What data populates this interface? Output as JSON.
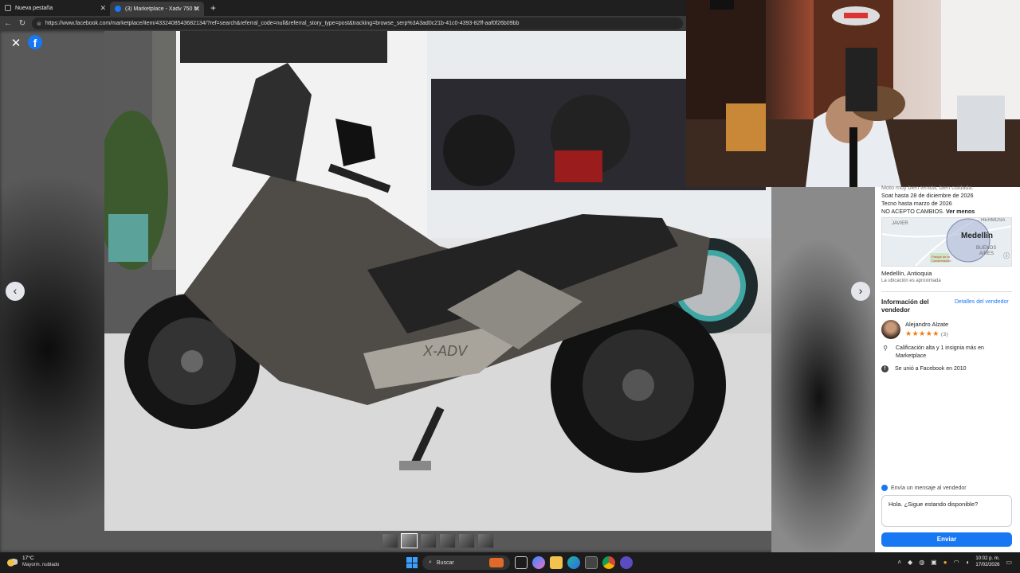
{
  "browser": {
    "tabs": [
      {
        "title": "Nueva pestaña"
      },
      {
        "title": "(3) Marketplace - Xadv 750 Mode..."
      }
    ],
    "url": "https://www.facebook.com/marketplace/item/4332408543682134/?ref=search&referral_code=null&referral_story_type=post&tracking=browse_serp%3A3ad0c21b-41c0-4393-82ff-aaf0f26b09bb"
  },
  "viewer": {
    "thumb_count": 6
  },
  "panel": {
    "desc_top": "Moto muy bien tenida, bien cuidada.",
    "desc_lines": [
      "Soat hasta 28 de diciembre de 2026",
      "Tecno hasta marzo de 2026",
      "NO ACEPTO CAMBIOS."
    ],
    "see_less": "Ver menos",
    "map": {
      "city": "Medellín",
      "labels": [
        "JAVIER",
        "HERMOSA",
        "BUENOS",
        "AIRES",
        "Parque de la Conservación"
      ]
    },
    "location": "Medellín, Antioquia",
    "location_note": "La ubicación es aproximada",
    "seller_section_title": "Información del vendedor",
    "seller_details_link": "Detalles del vendedor",
    "seller_name": "Alejandro Alzate",
    "rating_stars": "★★★★★",
    "rating_count": "(3)",
    "info_1": "Calificación alta y 1 insignia más en Marketplace",
    "info_2": "Se unió a Facebook en 2010",
    "message_label": "Envía un mensaje al vendedor",
    "message_text": "Hola. ¿Sigue estando disponible?",
    "send_label": "Enviar"
  },
  "taskbar": {
    "temp": "17°C",
    "weather": "Mayorm. nublado",
    "search": "Buscar",
    "time": "10:02 p. m.",
    "date": "17/02/2026"
  },
  "colors": {
    "brand": "#1877f2",
    "star": "#f2790f"
  }
}
